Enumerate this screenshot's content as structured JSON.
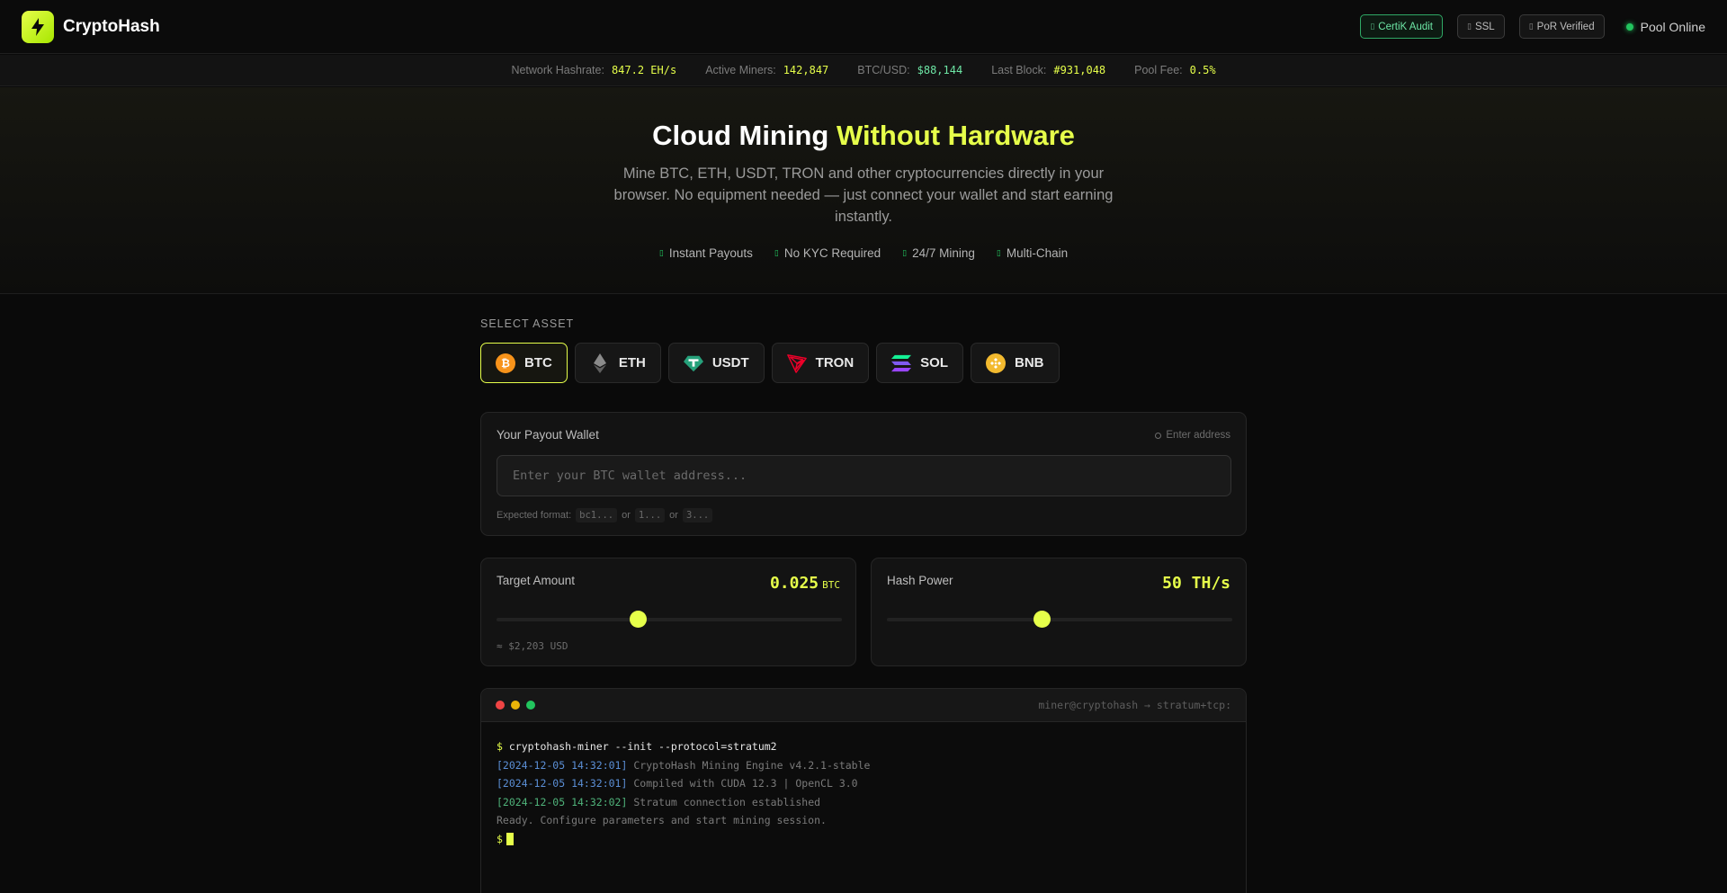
{
  "brand": {
    "name": "CryptoHash"
  },
  "header": {
    "badges": [
      {
        "label": "CertiK Audit",
        "glyph": "▯"
      },
      {
        "label": "SSL",
        "glyph": "▯"
      },
      {
        "label": "PoR Verified",
        "glyph": "▯"
      }
    ],
    "pool_status": "Pool Online"
  },
  "stats": [
    {
      "label": "Network Hashrate:",
      "value": "847.2 EH/s"
    },
    {
      "label": "Active Miners:",
      "value": "142,847"
    },
    {
      "label": "BTC/USD:",
      "value": "$88,144"
    },
    {
      "label": "Last Block:",
      "value": "#931,048"
    },
    {
      "label": "Pool Fee:",
      "value": "0.5%"
    }
  ],
  "hero": {
    "title_main": "Cloud Mining ",
    "title_accent": "Without Hardware",
    "subtitle": "Mine BTC, ETH, USDT, TRON and other cryptocurrencies directly in your browser. No equipment needed — just connect your wallet and start earning instantly.",
    "features": [
      "Instant Payouts",
      "No KYC Required",
      "24/7 Mining",
      "Multi-Chain"
    ]
  },
  "asset_select": {
    "label": "SELECT ASSET",
    "assets": [
      {
        "symbol": "BTC",
        "icon": "bitcoin-icon",
        "color": "#f7931a"
      },
      {
        "symbol": "ETH",
        "icon": "ethereum-icon",
        "color": "#627eea"
      },
      {
        "symbol": "USDT",
        "icon": "tether-icon",
        "color": "#26a17b"
      },
      {
        "symbol": "TRON",
        "icon": "tron-icon",
        "color": "#eb0029"
      },
      {
        "symbol": "SOL",
        "icon": "solana-icon",
        "color": "#9945ff"
      },
      {
        "symbol": "BNB",
        "icon": "bnb-icon",
        "color": "#f3ba2f"
      }
    ],
    "selected": "BTC"
  },
  "wallet": {
    "title": "Your Payout Wallet",
    "hint": "Enter address",
    "placeholder": "Enter your BTC wallet address...",
    "format_label": "Expected format:",
    "formats": [
      "bc1...",
      "1...",
      "3..."
    ],
    "format_sep": "or"
  },
  "target": {
    "title": "Target Amount",
    "value": "0.025",
    "unit": "BTC",
    "usd": "≈ $2,203 USD",
    "slider_fraction": 0.41
  },
  "hashpower": {
    "title": "Hash Power",
    "value": "50 TH/s",
    "slider_fraction": 0.45
  },
  "terminal": {
    "title": "miner@cryptohash → stratum+tcp:",
    "command": "cryptohash-miner --init --protocol=stratum2",
    "logs": [
      {
        "ts": "[2024-12-05 14:32:01]",
        "msg": "CryptoHash Mining Engine v4.2.1-stable"
      },
      {
        "ts": "[2024-12-05 14:32:01]",
        "msg": "Compiled with CUDA 12.3 | OpenCL 3.0"
      },
      {
        "ts": "[2024-12-05 14:32:02]",
        "msg": "Stratum connection established"
      }
    ],
    "ready": "Ready. Configure parameters and start mining session.",
    "prompt": "$"
  },
  "colors": {
    "accent": "#e6ff4a",
    "online": "#22c55e"
  }
}
